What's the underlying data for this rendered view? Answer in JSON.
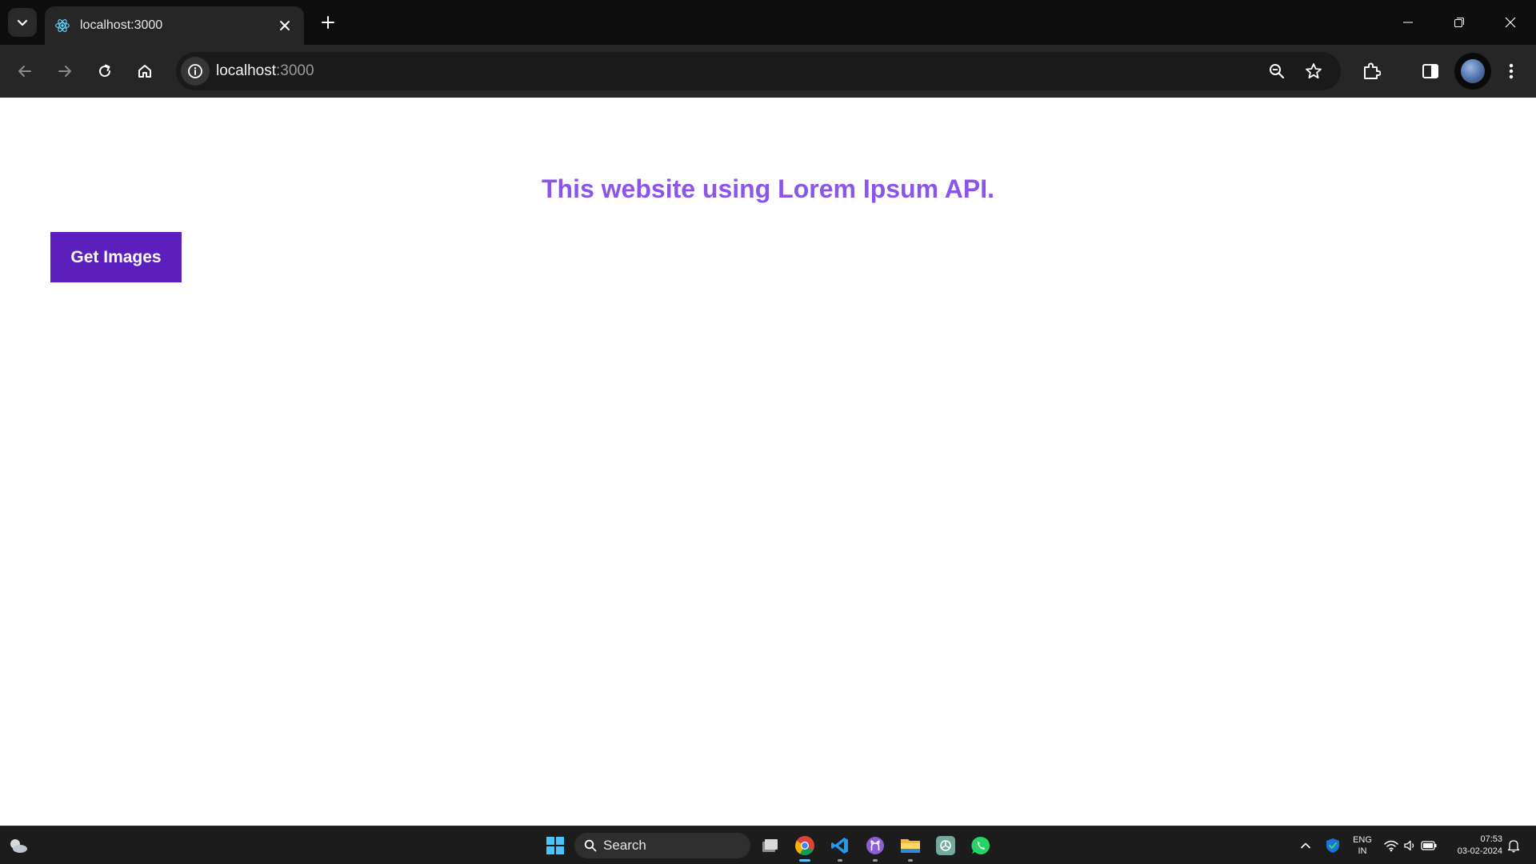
{
  "browser": {
    "tab": {
      "title": "localhost:3000",
      "favicon": "react-icon"
    },
    "url": {
      "host": "localhost",
      "port": ":3000"
    },
    "icons": {
      "tab_search": "chevron-down-icon",
      "close_tab": "close-icon",
      "new_tab": "plus-icon",
      "back": "arrow-left-icon",
      "forward": "arrow-right-icon",
      "reload": "reload-icon",
      "home": "home-icon",
      "site_info": "info-icon",
      "zoom": "zoom-out-icon",
      "bookmark": "star-icon",
      "extensions": "puzzle-icon",
      "side_panel": "side-panel-icon",
      "menu": "kebab-menu-icon"
    }
  },
  "page": {
    "heading": "This website using Lorem Ipsum API.",
    "button_label": "Get Images",
    "colors": {
      "heading": "#8a55ea",
      "button_bg": "#5a1fbd",
      "button_text": "#ffffff"
    }
  },
  "taskbar": {
    "search_label": "Search",
    "apps": [
      "windows-start-icon",
      "task-view-icon",
      "chrome-icon",
      "vscode-icon",
      "github-desktop-icon",
      "file-explorer-icon",
      "chatgpt-icon",
      "whatsapp-icon"
    ],
    "language": {
      "line1": "ENG",
      "line2": "IN"
    },
    "clock": {
      "time": "07:53",
      "date": "03-02-2024"
    }
  }
}
